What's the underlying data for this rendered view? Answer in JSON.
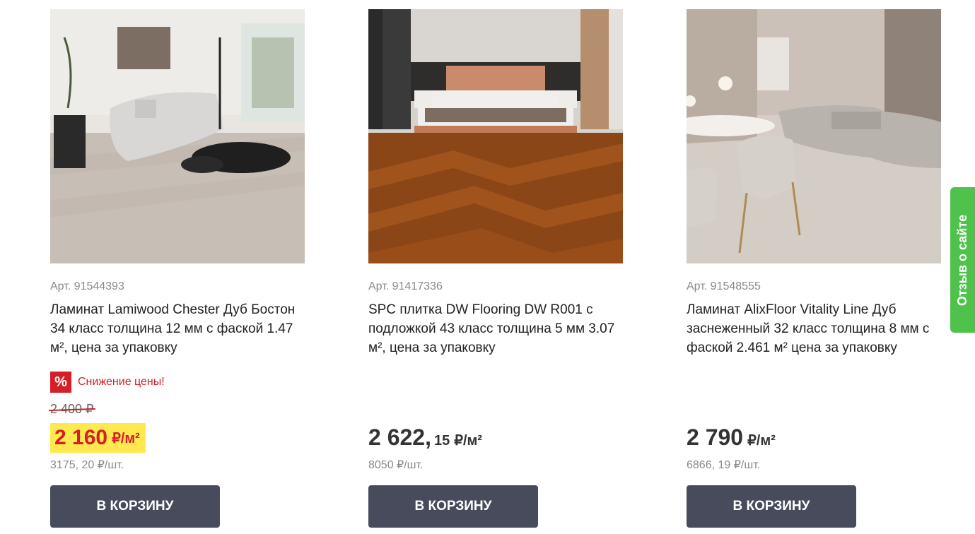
{
  "products": [
    {
      "article": "Арт. 91544393",
      "title": "Ламинат Lamiwood Chester Дуб Бостон 34 класс толщина 12 мм с фаской 1.47 м², цена за упаковку",
      "sale_badge": "%",
      "sale_text": "Снижение цены!",
      "old_price": "2 400 ₽",
      "price": "2 160",
      "price_unit": "₽/м²",
      "per_unit": "3175, 20 ₽/шт.",
      "button": "В КОРЗИНУ"
    },
    {
      "article": "Арт. 91417336",
      "title": "SPC плитка DW Flooring DW R001 с подложкой 43 класс толщина 5 мм 3.07 м², цена за упаковку",
      "price": "2 622,",
      "price_cents": "15",
      "price_unit": "₽/м²",
      "per_unit": "8050 ₽/шт.",
      "button": "В КОРЗИНУ"
    },
    {
      "article": "Арт. 91548555",
      "title": "Ламинат AlixFloor Vitality Line Дуб заснеженный 32 класс толщина 8 мм с фаской 2.461 м² цена за упаковку",
      "price": "2 790",
      "price_unit": "₽/м²",
      "per_unit": "6866, 19 ₽/шт.",
      "button": "В КОРЗИНУ"
    }
  ],
  "feedback_tab": "Отзыв о сайте",
  "colors": {
    "accent_red": "#d41f26",
    "highlight_yellow": "#ffe94f",
    "button_bg": "#474b5c",
    "feedback_green": "#4ec24a"
  }
}
